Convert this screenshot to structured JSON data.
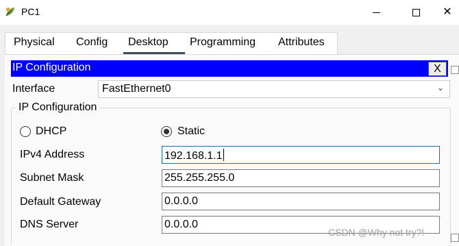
{
  "window": {
    "title": "PC1",
    "icon": "pc-leaf-icon",
    "controls": {
      "minimize": "minimize-icon",
      "maximize": "maximize-icon",
      "close": "close-icon"
    }
  },
  "tabs": [
    {
      "label": "Physical"
    },
    {
      "label": "Config"
    },
    {
      "label": "Desktop",
      "active": true
    },
    {
      "label": "Programming"
    },
    {
      "label": "Attributes"
    }
  ],
  "ip_configuration": {
    "header_title": "IP Configuration",
    "header_close": "X",
    "header_color": "#0000ff",
    "interface_label": "Interface",
    "interface_value": "FastEthernet0",
    "group_title": "IP Configuration",
    "dhcp_label": "DHCP",
    "static_label": "Static",
    "selected_mode": "Static",
    "fields": {
      "ipv4_label": "IPv4 Address",
      "ipv4_value": "192.168.1.1",
      "subnet_label": "Subnet Mask",
      "subnet_value": "255.255.255.0",
      "gateway_label": "Default Gateway",
      "gateway_value": "0.0.0.0",
      "dns_label": "DNS Server",
      "dns_value": "0.0.0.0"
    }
  },
  "watermark": "CSDN @Why not try?!"
}
